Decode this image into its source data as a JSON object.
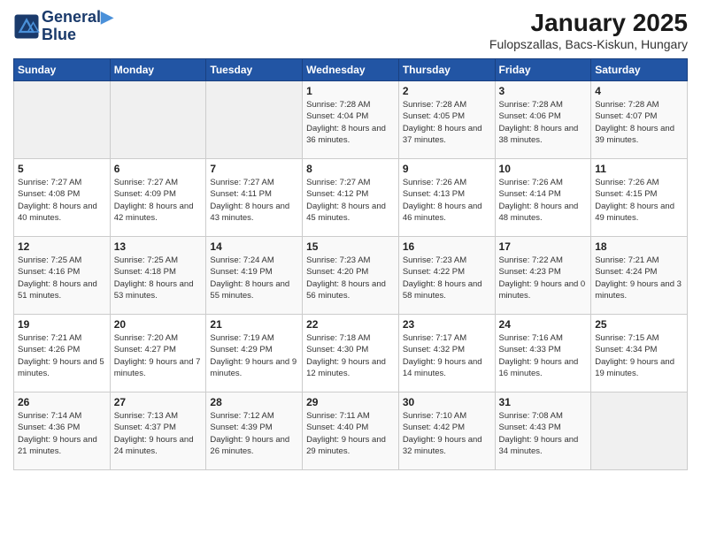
{
  "header": {
    "logo_line1": "General",
    "logo_line2": "Blue",
    "month_title": "January 2025",
    "subtitle": "Fulopszallas, Bacs-Kiskun, Hungary"
  },
  "weekdays": [
    "Sunday",
    "Monday",
    "Tuesday",
    "Wednesday",
    "Thursday",
    "Friday",
    "Saturday"
  ],
  "weeks": [
    [
      {
        "day": "",
        "info": ""
      },
      {
        "day": "",
        "info": ""
      },
      {
        "day": "",
        "info": ""
      },
      {
        "day": "1",
        "info": "Sunrise: 7:28 AM\nSunset: 4:04 PM\nDaylight: 8 hours and 36 minutes."
      },
      {
        "day": "2",
        "info": "Sunrise: 7:28 AM\nSunset: 4:05 PM\nDaylight: 8 hours and 37 minutes."
      },
      {
        "day": "3",
        "info": "Sunrise: 7:28 AM\nSunset: 4:06 PM\nDaylight: 8 hours and 38 minutes."
      },
      {
        "day": "4",
        "info": "Sunrise: 7:28 AM\nSunset: 4:07 PM\nDaylight: 8 hours and 39 minutes."
      }
    ],
    [
      {
        "day": "5",
        "info": "Sunrise: 7:27 AM\nSunset: 4:08 PM\nDaylight: 8 hours and 40 minutes."
      },
      {
        "day": "6",
        "info": "Sunrise: 7:27 AM\nSunset: 4:09 PM\nDaylight: 8 hours and 42 minutes."
      },
      {
        "day": "7",
        "info": "Sunrise: 7:27 AM\nSunset: 4:11 PM\nDaylight: 8 hours and 43 minutes."
      },
      {
        "day": "8",
        "info": "Sunrise: 7:27 AM\nSunset: 4:12 PM\nDaylight: 8 hours and 45 minutes."
      },
      {
        "day": "9",
        "info": "Sunrise: 7:26 AM\nSunset: 4:13 PM\nDaylight: 8 hours and 46 minutes."
      },
      {
        "day": "10",
        "info": "Sunrise: 7:26 AM\nSunset: 4:14 PM\nDaylight: 8 hours and 48 minutes."
      },
      {
        "day": "11",
        "info": "Sunrise: 7:26 AM\nSunset: 4:15 PM\nDaylight: 8 hours and 49 minutes."
      }
    ],
    [
      {
        "day": "12",
        "info": "Sunrise: 7:25 AM\nSunset: 4:16 PM\nDaylight: 8 hours and 51 minutes."
      },
      {
        "day": "13",
        "info": "Sunrise: 7:25 AM\nSunset: 4:18 PM\nDaylight: 8 hours and 53 minutes."
      },
      {
        "day": "14",
        "info": "Sunrise: 7:24 AM\nSunset: 4:19 PM\nDaylight: 8 hours and 55 minutes."
      },
      {
        "day": "15",
        "info": "Sunrise: 7:23 AM\nSunset: 4:20 PM\nDaylight: 8 hours and 56 minutes."
      },
      {
        "day": "16",
        "info": "Sunrise: 7:23 AM\nSunset: 4:22 PM\nDaylight: 8 hours and 58 minutes."
      },
      {
        "day": "17",
        "info": "Sunrise: 7:22 AM\nSunset: 4:23 PM\nDaylight: 9 hours and 0 minutes."
      },
      {
        "day": "18",
        "info": "Sunrise: 7:21 AM\nSunset: 4:24 PM\nDaylight: 9 hours and 3 minutes."
      }
    ],
    [
      {
        "day": "19",
        "info": "Sunrise: 7:21 AM\nSunset: 4:26 PM\nDaylight: 9 hours and 5 minutes."
      },
      {
        "day": "20",
        "info": "Sunrise: 7:20 AM\nSunset: 4:27 PM\nDaylight: 9 hours and 7 minutes."
      },
      {
        "day": "21",
        "info": "Sunrise: 7:19 AM\nSunset: 4:29 PM\nDaylight: 9 hours and 9 minutes."
      },
      {
        "day": "22",
        "info": "Sunrise: 7:18 AM\nSunset: 4:30 PM\nDaylight: 9 hours and 12 minutes."
      },
      {
        "day": "23",
        "info": "Sunrise: 7:17 AM\nSunset: 4:32 PM\nDaylight: 9 hours and 14 minutes."
      },
      {
        "day": "24",
        "info": "Sunrise: 7:16 AM\nSunset: 4:33 PM\nDaylight: 9 hours and 16 minutes."
      },
      {
        "day": "25",
        "info": "Sunrise: 7:15 AM\nSunset: 4:34 PM\nDaylight: 9 hours and 19 minutes."
      }
    ],
    [
      {
        "day": "26",
        "info": "Sunrise: 7:14 AM\nSunset: 4:36 PM\nDaylight: 9 hours and 21 minutes."
      },
      {
        "day": "27",
        "info": "Sunrise: 7:13 AM\nSunset: 4:37 PM\nDaylight: 9 hours and 24 minutes."
      },
      {
        "day": "28",
        "info": "Sunrise: 7:12 AM\nSunset: 4:39 PM\nDaylight: 9 hours and 26 minutes."
      },
      {
        "day": "29",
        "info": "Sunrise: 7:11 AM\nSunset: 4:40 PM\nDaylight: 9 hours and 29 minutes."
      },
      {
        "day": "30",
        "info": "Sunrise: 7:10 AM\nSunset: 4:42 PM\nDaylight: 9 hours and 32 minutes."
      },
      {
        "day": "31",
        "info": "Sunrise: 7:08 AM\nSunset: 4:43 PM\nDaylight: 9 hours and 34 minutes."
      },
      {
        "day": "",
        "info": ""
      }
    ]
  ]
}
